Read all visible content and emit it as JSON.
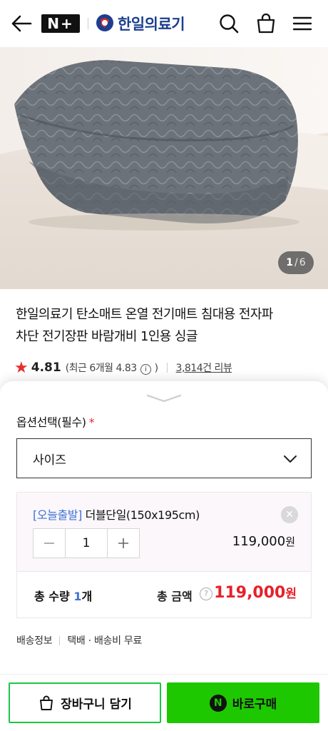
{
  "header": {
    "badge": "N+",
    "brand": "한일의료기"
  },
  "gallery": {
    "current": "1",
    "separator": "/",
    "total": "6"
  },
  "product": {
    "title_line1": "한일의료기 탄소매트 온열 전기매트 침대용 전자파",
    "title_line2": "차단 전기장판 바람개비 1인용 싱글",
    "rating": "4.81",
    "recent_prefix": "(최근 6개월 4.83",
    "recent_info": "i",
    "recent_suffix": ")",
    "reviews": "3,814건 리뷰"
  },
  "options": {
    "label": "옵션선택(필수)",
    "required_mark": "*",
    "select_value": "사이즈"
  },
  "selected_item": {
    "tag": "[오늘출발]",
    "name": "더블단일(150x195cm)",
    "quantity": "1",
    "price": "119,000",
    "currency": "원",
    "remove": "✕"
  },
  "total": {
    "qty_label": "총 수량",
    "qty": "1",
    "qty_unit": "개",
    "amount_label": "총 금액",
    "help": "?",
    "amount": "119,000",
    "currency": "원"
  },
  "shipping": {
    "label": "배송정보",
    "value": "택배 · 배송비 무료"
  },
  "buttons": {
    "cart": "장바구니 담기",
    "buy": "바로구매",
    "npay": "N"
  },
  "colors": {
    "accent_green": "#1ec800",
    "price_red": "#e5212a",
    "link_blue": "#3d72d6"
  }
}
